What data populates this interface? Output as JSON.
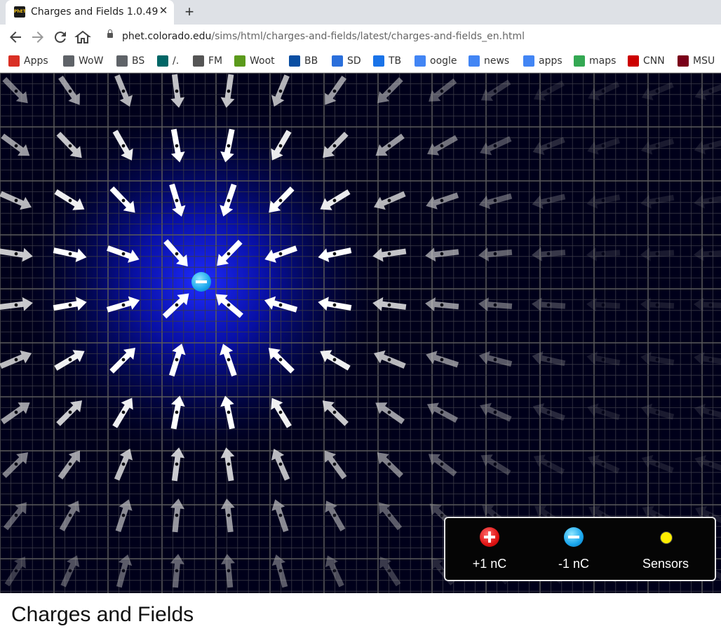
{
  "browser": {
    "tab_title": "Charges and Fields 1.0.49",
    "favicon_text": "PhET",
    "url_host": "phet.colorado.edu",
    "url_path": "/sims/html/charges-and-fields/latest/charges-and-fields_en.html",
    "bookmarks": [
      {
        "label": "Apps",
        "icon": "apps-grid-icon",
        "color": "#d93025"
      },
      {
        "label": "WoW",
        "icon": "folder-icon",
        "color": "#5f6368"
      },
      {
        "label": "BS",
        "icon": "folder-icon",
        "color": "#5f6368"
      },
      {
        "label": "/.",
        "icon": "slashdot-icon",
        "color": "#006666"
      },
      {
        "label": "FM",
        "icon": "fm-icon",
        "color": "#555555"
      },
      {
        "label": "Woot",
        "icon": "woot-icon",
        "color": "#5b9a1c"
      },
      {
        "label": "BB",
        "icon": "bestbuy-icon",
        "color": "#0a4ea2"
      },
      {
        "label": "SD",
        "icon": "sd-icon",
        "color": "#2a6fdb"
      },
      {
        "label": "TB",
        "icon": "tb-icon",
        "color": "#1a73e8"
      },
      {
        "label": "oogle",
        "icon": "google-icon",
        "color": "#4285f4"
      },
      {
        "label": "news",
        "icon": "google-news-icon",
        "color": "#4285f4"
      },
      {
        "label": "apps",
        "icon": "google-icon",
        "color": "#4285f4"
      },
      {
        "label": "maps",
        "icon": "maps-pin-icon",
        "color": "#34a853"
      },
      {
        "label": "CNN",
        "icon": "cnn-icon",
        "color": "#cc0000"
      },
      {
        "label": "MSU",
        "icon": "msu-icon",
        "color": "#7a0019"
      }
    ]
  },
  "sim": {
    "background_color": "#00001a",
    "placed_charge": {
      "label": "−",
      "type": "negative"
    },
    "panel": {
      "positive_label": "+1 nC",
      "negative_label": "-1 nC",
      "sensors_label": "Sensors"
    },
    "colors": {
      "positive": "#e01515",
      "negative": "#19a6ee",
      "sensor": "#ffee00"
    }
  },
  "page": {
    "title": "Charges and Fields"
  }
}
